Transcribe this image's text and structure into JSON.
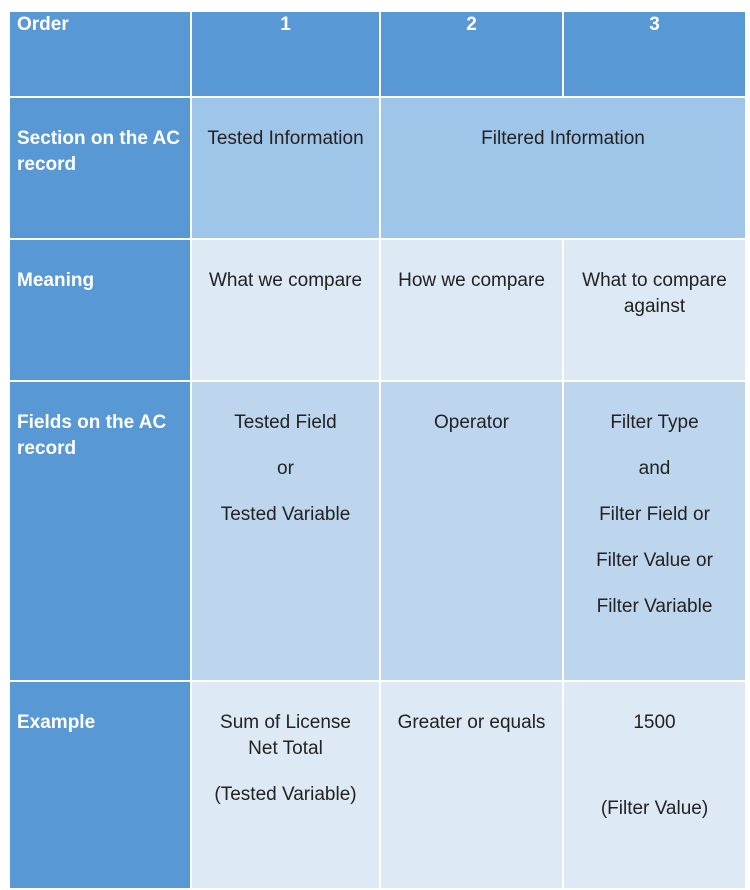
{
  "table": {
    "header_row": {
      "label": "Order",
      "columns": [
        "1",
        "2",
        "3"
      ]
    },
    "section_row": {
      "label": "Section on the AC record",
      "tested": "Tested Information",
      "filtered": "Filtered Information"
    },
    "meaning_row": {
      "label": "Meaning",
      "cells": [
        "What we compare",
        "How we compare",
        "What to compare against"
      ]
    },
    "fields_row": {
      "label": "Fields on the AC record",
      "col1": [
        "Tested Field",
        "or",
        "Tested Variable"
      ],
      "col2": [
        "Operator"
      ],
      "col3": [
        "Filter Type",
        "and",
        "Filter Field or",
        "Filter Value or",
        "Filter Variable"
      ]
    },
    "example_row": {
      "label": "Example",
      "col1_line1": "Sum of License",
      "col1_line2": "Net Total",
      "col1_note": "(Tested Variable)",
      "col2": "Greater or equals",
      "col3_value": "1500",
      "col3_note": "(Filter Value)"
    }
  },
  "colors": {
    "header_blue": "#5898d4",
    "section_blue": "#9fc5e8",
    "light_blue": "#dde9f5",
    "mid_blue": "#bdd6ee"
  }
}
